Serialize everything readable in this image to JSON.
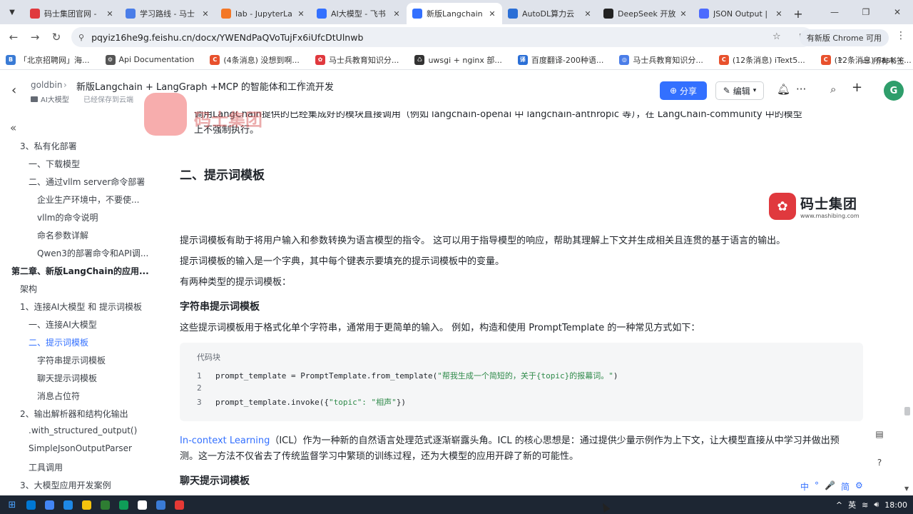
{
  "browser": {
    "tabs": [
      {
        "title": "码士集团官网 - ",
        "icon": "mashibing-icon",
        "color": "#e0393e"
      },
      {
        "title": "学习路线 - 马士",
        "icon": "globe-icon",
        "color": "#4a7de8"
      },
      {
        "title": "lab - JupyterLa",
        "icon": "jupyter-icon",
        "color": "#f37726"
      },
      {
        "title": "AI大模型 - 飞书",
        "icon": "feishu-icon",
        "color": "#3370ff"
      },
      {
        "title": "新版Langchain",
        "icon": "feishu-doc-icon",
        "color": "#3370ff",
        "active": true
      },
      {
        "title": "AutoDL算力云",
        "icon": "autodl-icon",
        "color": "#2b6fd6"
      },
      {
        "title": "DeepSeek 开放",
        "icon": "github-icon",
        "color": "#222222"
      },
      {
        "title": "JSON Output |",
        "icon": "deepseek-icon",
        "color": "#4d6bfe"
      }
    ],
    "url": "pqyiz16he9g.feishu.cn/docx/YWENdPaQVoTujFx6iUfcDtUlnwb",
    "profile_chip": "有新版 Chrome 可用",
    "bookmarks": [
      {
        "label": "「北京招聘网」海...",
        "color": "#3a7bd5",
        "mark": "B"
      },
      {
        "label": "Api Documentation",
        "color": "#555555",
        "mark": "⚙"
      },
      {
        "label": "(4条消息) 没想到啊...",
        "color": "#e8512d",
        "mark": "C"
      },
      {
        "label": "马士兵教育知识分...",
        "color": "#e0393e",
        "mark": "✿"
      },
      {
        "label": "uwsgi + nginx 部...",
        "color": "#333333",
        "mark": "♺"
      },
      {
        "label": "百度翻译-200种语...",
        "color": "#2b6fd6",
        "mark": "译"
      },
      {
        "label": "马士兵教育知识分...",
        "color": "#4a7de8",
        "mark": "◎"
      },
      {
        "label": "(12条消息) iText5...",
        "color": "#e8512d",
        "mark": "C"
      },
      {
        "label": "(12条消息) flask +...",
        "color": "#e8512d",
        "mark": "C"
      }
    ],
    "bookmarks_all": "所有书签"
  },
  "doc_header": {
    "owner": "goldbin",
    "title": "新版Langchain + LangGraph +MCP 的智能体和工作流开发",
    "folder": "AI大模型",
    "save_status": "已经保存到云端",
    "share_label": "分享",
    "edit_label": "编辑",
    "avatar_letter": "G"
  },
  "toc": [
    {
      "label": "3、私有化部署",
      "level": 1
    },
    {
      "label": "一、下载模型",
      "level": 2
    },
    {
      "label": "二、通过vllm server命令部署",
      "level": 2
    },
    {
      "label": "企业生产环境中，不要使...",
      "level": 3
    },
    {
      "label": "vllm的命令说明",
      "level": 3
    },
    {
      "label": "命名参数详解",
      "level": 3
    },
    {
      "label": "Qwen3的部署命令和API调...",
      "level": 3
    },
    {
      "label": "第二章、新版LangChain的应用...",
      "level": 0,
      "bold": true
    },
    {
      "label": "架构",
      "level": 1
    },
    {
      "label": "1、连接AI大模型 和 提示词模板",
      "level": 1
    },
    {
      "label": "一、连接AI大模型",
      "level": 2
    },
    {
      "label": "二、提示词模板",
      "level": 2,
      "active": true
    },
    {
      "label": "字符串提示词模板",
      "level": 3
    },
    {
      "label": "聊天提示词模板",
      "level": 3
    },
    {
      "label": "消息占位符",
      "level": 3
    },
    {
      "label": "2、输出解析器和结构化输出",
      "level": 1
    },
    {
      "label": ".with_structured_output()",
      "level": 2
    },
    {
      "label": "SimpleJsonOutputParser",
      "level": 2
    },
    {
      "label": "工具调用",
      "level": 2
    },
    {
      "label": "3、大模型应用开发案例",
      "level": 1
    }
  ],
  "watermark": {
    "text": "码士集团"
  },
  "content": {
    "truncated_line_1": "调用LangChain提供的已经集成好的模块直接调用（例如 langchain-openai 中 langchain-anthropic 等），在 LangChain-community 中的模型",
    "truncated_line_2": "上不强制执行。",
    "section_heading": "二、提示词模板",
    "brand_name": "码士集团",
    "brand_url": "www.mashibing.com",
    "para1": "提示词模板有助于将用户输入和参数转换为语言模型的指令。 这可以用于指导模型的响应，帮助其理解上下文并生成相关且连贯的基于语言的输出。",
    "para2": "提示词模板的输入是一个字典，其中每个键表示要填充的提示词模板中的变量。",
    "para3": "有两种类型的提示词模板：",
    "sub_heading_1": "字符串提示词模板",
    "para4": "这些提示词模板用于格式化单个字符串，通常用于更简单的输入。 例如，构造和使用 PromptTemplate 的一种常见方式如下：",
    "code_label": "代码块",
    "code": [
      {
        "num": "1",
        "pre": "prompt_template = PromptTemplate.from_template(",
        "str": "\"帮我生成一个简短的，关于{topic}的报幕词。\"",
        "post": ")"
      },
      {
        "num": "2",
        "pre": "",
        "str": "",
        "post": ""
      },
      {
        "num": "3",
        "pre": "prompt_template.invoke({",
        "str": "\"topic\": \"相声\"",
        "post": "})"
      }
    ],
    "icl_link": "In-context Learning",
    "para5_rest": "（ICL）作为一种新的自然语言处理范式逐渐崭露头角。ICL 的核心思想是：通过提供少量示例作为上下文，让大模型直接从中学习并做出预",
    "para6": "测。这一方法不仅省去了传统监督学习中繁琐的训练过程，还为大模型的应用开辟了新的可能性。",
    "sub_heading_2": "聊天提示词模板"
  },
  "ime": [
    "中",
    "°",
    "🎤",
    "简",
    "⚙"
  ],
  "taskbar": {
    "apps": [
      "#0078d4",
      "#4285f4",
      "#1e88e5",
      "#f4c20d",
      "#2e7d32",
      "#0f9d58",
      "#ffffff",
      "#3a7bd5",
      "#e53935"
    ],
    "time": "18:00"
  },
  "colors": {
    "accent": "#3370ff",
    "link": "#3370ff",
    "code_string": "#2f8a4a"
  }
}
